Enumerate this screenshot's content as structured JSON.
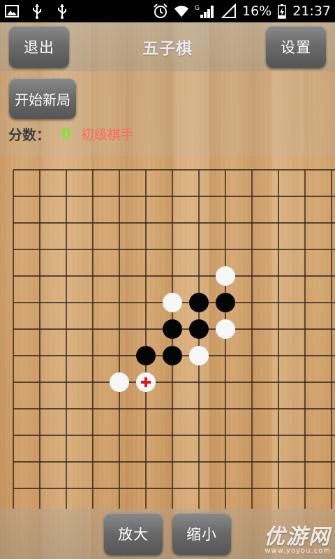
{
  "status_bar": {
    "battery": "16%",
    "time": "21:37",
    "network": "G",
    "icons": [
      "image-icon",
      "usb-icon",
      "usb-icon",
      "alarm-icon",
      "wifi-icon",
      "signal-icon",
      "signal-empty-icon",
      "battery-charging-icon"
    ]
  },
  "titlebar": {
    "exit_label": "退出",
    "title": "五子棋",
    "settings_label": "设置"
  },
  "game": {
    "new_game_label": "开始新局",
    "score_label": "分数：",
    "score_value": "0",
    "rank": "初级棋手"
  },
  "board": {
    "columns": 13,
    "rows": 14,
    "stones": [
      {
        "col": 8,
        "row": 4,
        "color": "white"
      },
      {
        "col": 6,
        "row": 5,
        "color": "white"
      },
      {
        "col": 7,
        "row": 5,
        "color": "black"
      },
      {
        "col": 8,
        "row": 5,
        "color": "black"
      },
      {
        "col": 6,
        "row": 6,
        "color": "black"
      },
      {
        "col": 7,
        "row": 6,
        "color": "black"
      },
      {
        "col": 8,
        "row": 6,
        "color": "white"
      },
      {
        "col": 5,
        "row": 7,
        "color": "black"
      },
      {
        "col": 6,
        "row": 7,
        "color": "black"
      },
      {
        "col": 7,
        "row": 7,
        "color": "white"
      },
      {
        "col": 4,
        "row": 8,
        "color": "white"
      },
      {
        "col": 5,
        "row": 8,
        "color": "white"
      }
    ],
    "last_move": {
      "col": 5,
      "row": 8
    },
    "colors": {
      "line": "#2a2118",
      "black_stone": "#050505",
      "white_stone": "#f7f7f7",
      "marker": "#e0151b"
    }
  },
  "controls": {
    "zoom_in_label": "放大",
    "zoom_out_label": "缩小"
  },
  "watermark": {
    "brand": "优游网",
    "url": "www.yoyou.com"
  }
}
